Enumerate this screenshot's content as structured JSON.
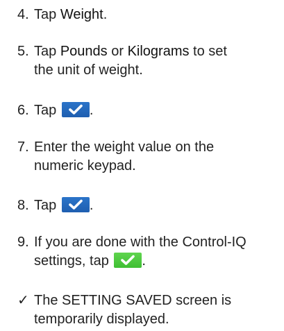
{
  "steps": [
    {
      "num": "4.",
      "pre": "Tap ",
      "term": "Weight",
      "post": "."
    },
    {
      "num": "5.",
      "pre": "Tap ",
      "term1": "Pounds",
      "mid": " or ",
      "term2": "Kilograms",
      "post": " to set",
      "line2": "the unit of weight."
    },
    {
      "num": "6.",
      "pre": "Tap ",
      "post": ".",
      "button": {
        "icon": "checkmark-icon",
        "color": "#2b74c9"
      }
    },
    {
      "num": "7.",
      "line1": "Enter the weight value on the",
      "line2": "numeric keypad."
    },
    {
      "num": "8.",
      "pre": "Tap ",
      "post": ".",
      "button": {
        "icon": "checkmark-icon",
        "color": "#2b74c9"
      }
    },
    {
      "num": "9.",
      "line1": "If you are done with the Control-IQ",
      "pre2": "settings, tap ",
      "post": ".",
      "button": {
        "icon": "checkmark-icon",
        "color": "#4fcb40"
      }
    }
  ],
  "result": {
    "mark": "✓",
    "line1": "The SETTING SAVED screen is",
    "line2": "temporarily displayed."
  }
}
